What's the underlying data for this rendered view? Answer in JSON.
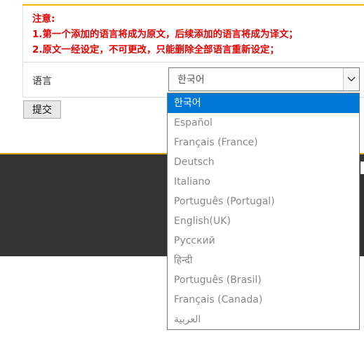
{
  "notice": {
    "title": "注意:",
    "line1": "1.第一个添加的语言将成为原文，后续添加的语言将成为译文；",
    "line2": "2.原文一经设定，不可更改，只能删除全部语言重新设定；"
  },
  "form": {
    "language_label": "语言",
    "selected_value": "한국어",
    "submit_label": "提交"
  },
  "dropdown": {
    "options": [
      "한국어",
      "Español",
      "Français (France)",
      "Deutsch",
      "Italiano",
      "Português (Portugal)",
      "English(UK)",
      "Русский",
      "हिन्दी",
      "Português (Brasil)",
      "Français (Canada)",
      "العربية"
    ]
  },
  "colors": {
    "accent": "#f0b400",
    "notice_text": "#e60000",
    "selected_bg": "#0078d7",
    "dark_band": "#333333"
  },
  "icons": {
    "select_arrow": "chevron-down-icon"
  }
}
